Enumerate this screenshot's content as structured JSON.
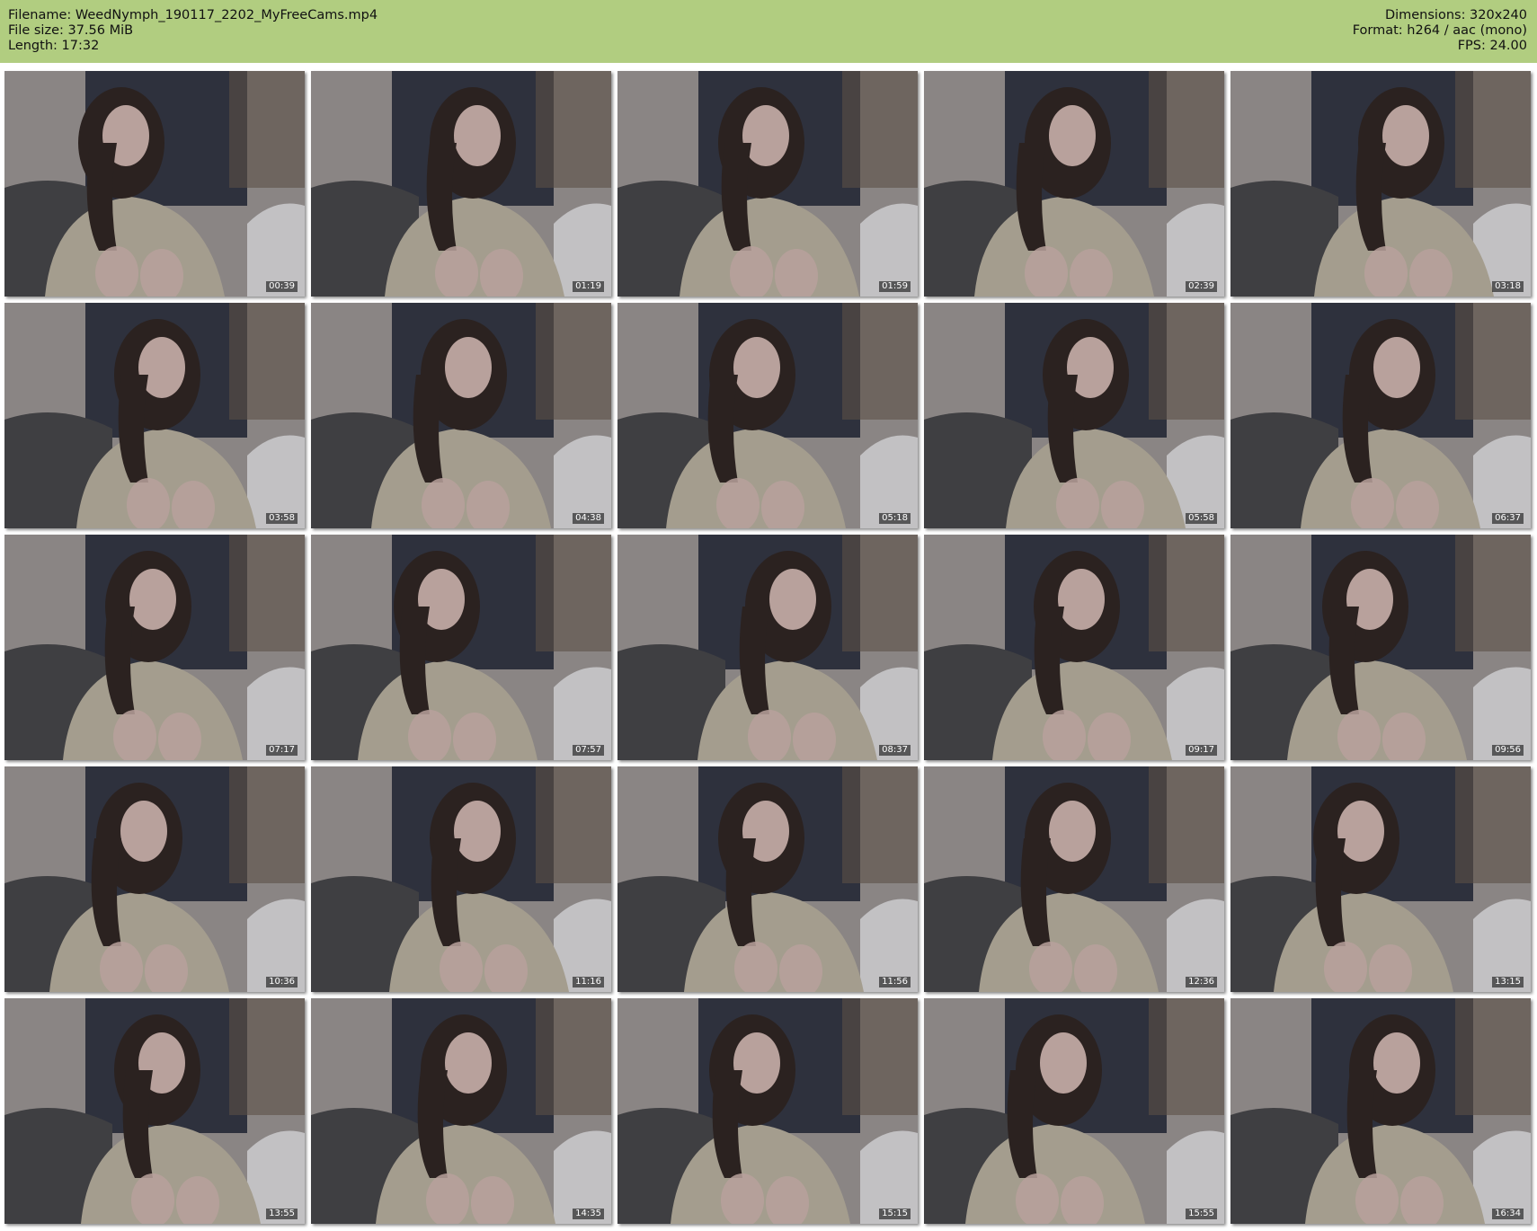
{
  "header": {
    "filename_label": "Filename: WeedNymph_190117_2202_MyFreeCams.mp4",
    "filesize_label": "File size: 37.56 MiB",
    "length_label": "Length: 17:32",
    "dimensions_label": "Dimensions: 320x240",
    "format_label": "Format: h264 / aac (mono)",
    "fps_label": "FPS: 24.00"
  },
  "colors": {
    "header_bg": "#b1cd80",
    "page_bg": "#ffffff",
    "wall": "#8a8584",
    "couch": "#3f3f42",
    "hair": "#2b2220",
    "sweater": "#a49d8e",
    "skin": "#b8a19c"
  },
  "thumbnails": [
    {
      "timestamp": "00:39"
    },
    {
      "timestamp": "01:19"
    },
    {
      "timestamp": "01:59"
    },
    {
      "timestamp": "02:39"
    },
    {
      "timestamp": "03:18"
    },
    {
      "timestamp": "03:58"
    },
    {
      "timestamp": "04:38"
    },
    {
      "timestamp": "05:18"
    },
    {
      "timestamp": "05:58"
    },
    {
      "timestamp": "06:37"
    },
    {
      "timestamp": "07:17"
    },
    {
      "timestamp": "07:57"
    },
    {
      "timestamp": "08:37"
    },
    {
      "timestamp": "09:17"
    },
    {
      "timestamp": "09:56"
    },
    {
      "timestamp": "10:36"
    },
    {
      "timestamp": "11:16"
    },
    {
      "timestamp": "11:56"
    },
    {
      "timestamp": "12:36"
    },
    {
      "timestamp": "13:15"
    },
    {
      "timestamp": "13:55"
    },
    {
      "timestamp": "14:35"
    },
    {
      "timestamp": "15:15"
    },
    {
      "timestamp": "15:55"
    },
    {
      "timestamp": "16:34"
    }
  ]
}
